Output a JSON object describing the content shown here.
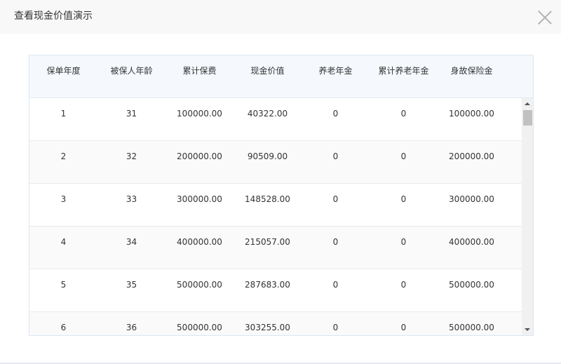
{
  "dialog": {
    "title": "查看现金价值演示"
  },
  "table": {
    "columns": [
      "保单年度",
      "被保人年龄",
      "累计保费",
      "现金价值",
      "养老年金",
      "累计养老年金",
      "身故保险金"
    ],
    "rows": [
      [
        "1",
        "31",
        "100000.00",
        "40322.00",
        "0",
        "0",
        "100000.00"
      ],
      [
        "2",
        "32",
        "200000.00",
        "90509.00",
        "0",
        "0",
        "200000.00"
      ],
      [
        "3",
        "33",
        "300000.00",
        "148528.00",
        "0",
        "0",
        "300000.00"
      ],
      [
        "4",
        "34",
        "400000.00",
        "215057.00",
        "0",
        "0",
        "400000.00"
      ],
      [
        "5",
        "35",
        "500000.00",
        "287683.00",
        "0",
        "0",
        "500000.00"
      ],
      [
        "6",
        "36",
        "500000.00",
        "303255.00",
        "0",
        "0",
        "500000.00"
      ]
    ]
  }
}
